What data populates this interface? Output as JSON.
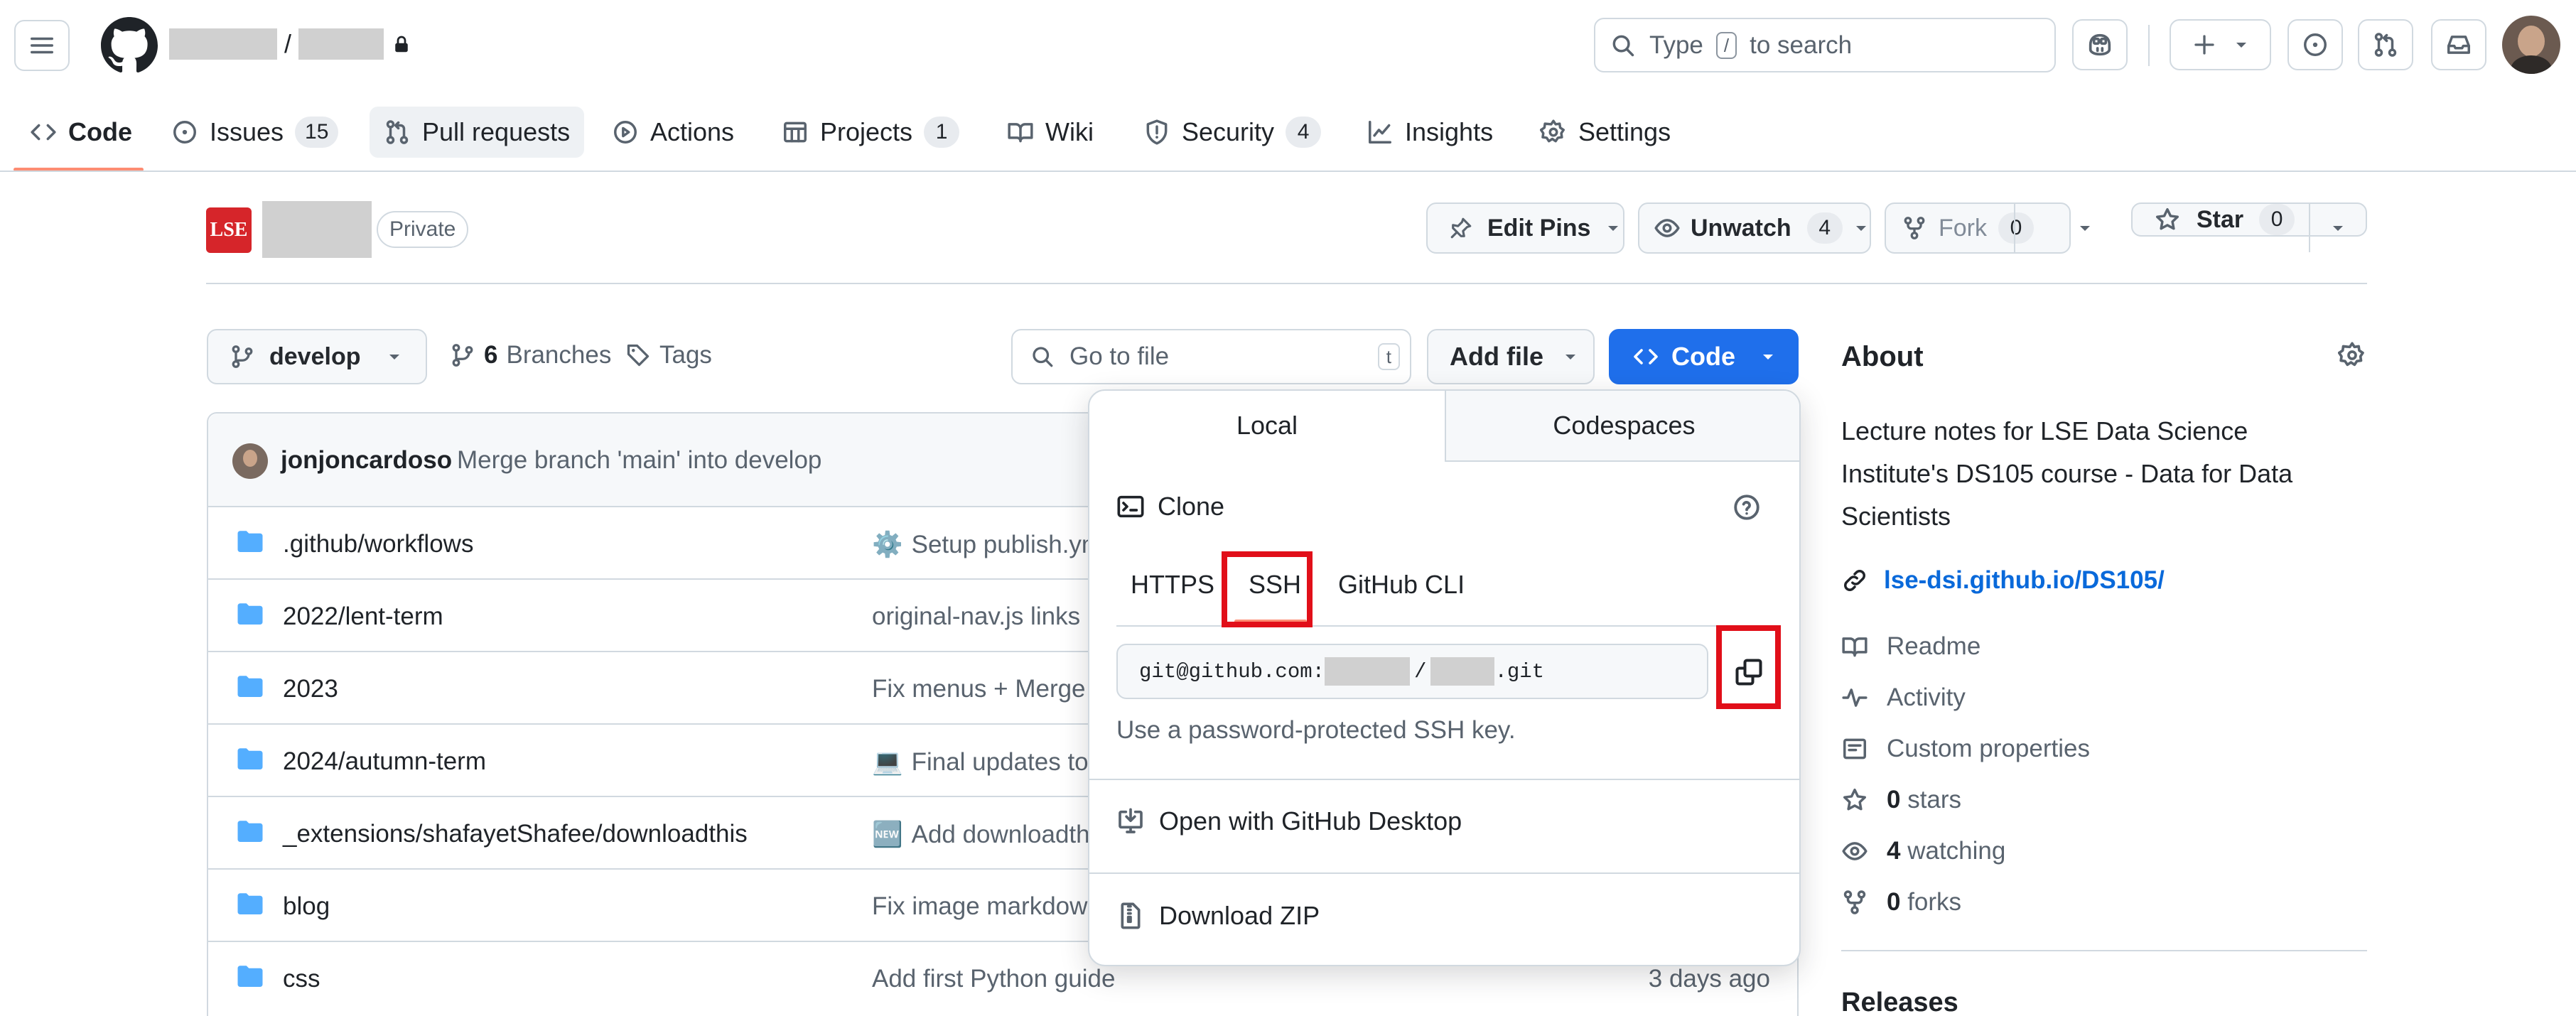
{
  "header": {
    "owner_placeholder": "",
    "separator": "/",
    "repo_placeholder": "",
    "search_placeholder_pre": "Type",
    "search_key": "/",
    "search_placeholder_post": "to search"
  },
  "repo_nav": {
    "tabs": [
      {
        "label": "Code",
        "count": "",
        "icon": "code-icon"
      },
      {
        "label": "Issues",
        "count": "15",
        "icon": "issue-icon"
      },
      {
        "label": "Pull requests",
        "count": "",
        "icon": "pull-request-icon"
      },
      {
        "label": "Actions",
        "count": "",
        "icon": "play-icon"
      },
      {
        "label": "Projects",
        "count": "1",
        "icon": "table-icon"
      },
      {
        "label": "Wiki",
        "count": "",
        "icon": "book-icon"
      },
      {
        "label": "Security",
        "count": "4",
        "icon": "shield-icon"
      },
      {
        "label": "Insights",
        "count": "",
        "icon": "graph-icon"
      },
      {
        "label": "Settings",
        "count": "",
        "icon": "gear-icon"
      }
    ]
  },
  "repo_header": {
    "logo_text": "LSE",
    "visibility": "Private",
    "edit_pins": "Edit Pins",
    "unwatch": "Unwatch",
    "watch_count": "4",
    "fork": "Fork",
    "fork_count": "0",
    "star": "Star",
    "star_count": "0"
  },
  "file_nav": {
    "branch": "develop",
    "branches_count": "6",
    "branches_label": "Branches",
    "tags_label": "Tags",
    "goto_placeholder": "Go to file",
    "goto_key": "t",
    "add_file": "Add file",
    "code": "Code"
  },
  "commit": {
    "author": "jonjoncardoso",
    "message": "Merge branch 'main' into develop"
  },
  "files": [
    {
      "name": ".github/workflows",
      "message": "Setup publish.ym",
      "emoji": "⚙️",
      "time": ""
    },
    {
      "name": "2022/lent-term",
      "message": "original-nav.js links",
      "emoji": "",
      "time": ""
    },
    {
      "name": "2023",
      "message": "Fix menus + Merge",
      "emoji": "",
      "time": ""
    },
    {
      "name": "2024/autumn-term",
      "message": "Final updates to",
      "emoji": "💻",
      "time": ""
    },
    {
      "name": "_extensions/shafayetShafee/downloadthis",
      "message": "Add downloadth",
      "emoji": "🆕",
      "time": ""
    },
    {
      "name": "blog",
      "message": "Fix image markdown",
      "emoji": "",
      "time": ""
    },
    {
      "name": "css",
      "message": "Add first Python guide",
      "emoji": "",
      "time": "3 days ago"
    }
  ],
  "clone_panel": {
    "tab_local": "Local",
    "tab_codespaces": "Codespaces",
    "clone_title": "Clone",
    "protocols": [
      "HTTPS",
      "SSH",
      "GitHub CLI"
    ],
    "url_prefix": "git@github.com:",
    "url_sep": "/",
    "url_suffix": ".git",
    "hint": "Use a password-protected SSH key.",
    "open_desktop": "Open with GitHub Desktop",
    "download_zip": "Download ZIP"
  },
  "about": {
    "title": "About",
    "description_lines": [
      "Lecture notes for LSE Data Science",
      "Institute's DS105 course - Data for Data",
      "Scientists"
    ],
    "link": "lse-dsi.github.io/DS105/",
    "items": [
      {
        "icon": "book-icon",
        "label": "Readme"
      },
      {
        "icon": "pulse-icon",
        "label": "Activity"
      },
      {
        "icon": "note-icon",
        "label": "Custom properties"
      }
    ],
    "stars_count": "0",
    "stars_label": "stars",
    "watching_count": "4",
    "watching_label": "watching",
    "forks_count": "0",
    "forks_label": "forks",
    "releases": "Releases"
  },
  "colors": {
    "accent": "#0969da",
    "code_button": "#1f6feb",
    "highlight": "#e10f19",
    "active_tab": "#fd8c73"
  }
}
